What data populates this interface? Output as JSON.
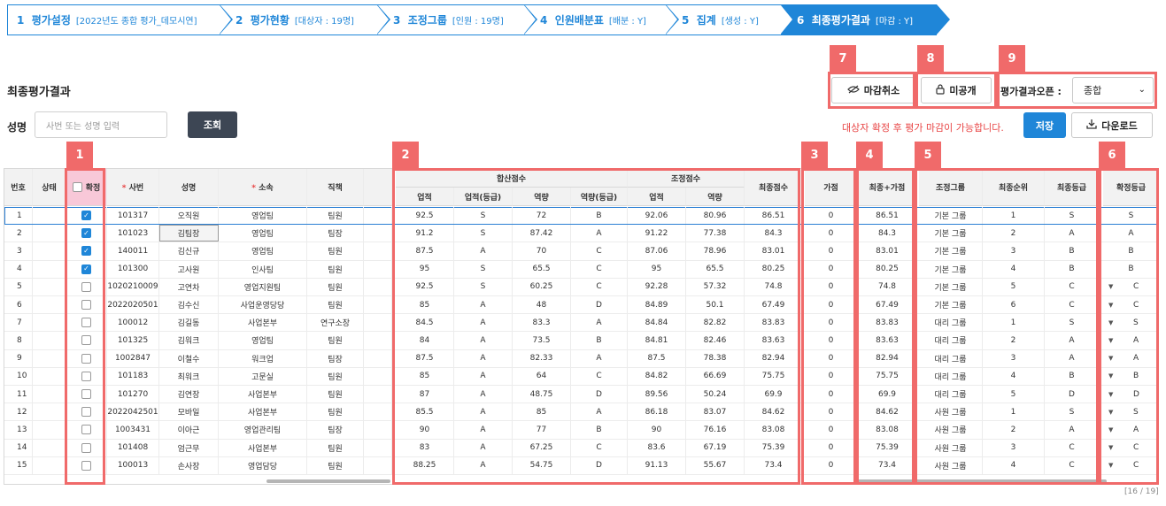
{
  "steps": [
    {
      "num": "1",
      "label": "평가설정",
      "detail": "[2022년도 종합 평가_데모시연]"
    },
    {
      "num": "2",
      "label": "평가현황",
      "detail": "[대상자 : 19명]"
    },
    {
      "num": "3",
      "label": "조정그룹",
      "detail": "[인원 : 19명]"
    },
    {
      "num": "4",
      "label": "인원배분표",
      "detail": "[배분 : Y]"
    },
    {
      "num": "5",
      "label": "집계",
      "detail": "[생성 : Y]"
    },
    {
      "num": "6",
      "label": "최종평가결과",
      "detail": "[마감 : Y]"
    }
  ],
  "page_title": "최종평가결과",
  "toolbar": {
    "close_cancel": "마감취소",
    "private": "미공개",
    "open_label": "평가결과오픈 :",
    "open_value": "종합",
    "notice": "대상자 확정 후 평가 마감이 가능합니다.",
    "save": "저장",
    "download": "다운로드"
  },
  "search": {
    "label": "성명",
    "placeholder": "사번 또는 성명 입력",
    "button": "조회"
  },
  "annotations": [
    "1",
    "2",
    "3",
    "4",
    "5",
    "6",
    "7",
    "8",
    "9"
  ],
  "grid": {
    "group_headers": {
      "sum": "합산점수",
      "adj": "조정점수"
    },
    "headers": {
      "no": "번호",
      "status": "상태",
      "confirm": "확정",
      "emp_no": "사번",
      "name": "성명",
      "dept": "소속",
      "title": "직책",
      "perf": "업적",
      "perf_grade": "업적(등급)",
      "comp": "역량",
      "comp_grade": "역량(등급)",
      "adj_perf": "업적",
      "adj_comp": "역량",
      "final_score": "최종점수",
      "bonus": "가점",
      "final_plus": "최종+가점",
      "adj_group": "조정그룹",
      "final_rank": "최종순위",
      "final_grade": "최종등급",
      "confirmed_grade": "확정등급"
    },
    "rows": [
      {
        "no": "1",
        "checked": true,
        "emp_no": "101317",
        "name": "오직원",
        "dept": "영업팀",
        "title": "팀원",
        "perf": "92.5",
        "perf_grade": "S",
        "comp": "72",
        "comp_grade": "B",
        "adj_perf": "92.06",
        "adj_comp": "80.96",
        "final_score": "86.51",
        "bonus": "0",
        "final_plus": "86.51",
        "adj_group": "기본 그룹",
        "final_rank": "1",
        "final_grade": "S",
        "confirmed_grade": "S",
        "dropdown": false
      },
      {
        "no": "2",
        "checked": true,
        "emp_no": "101023",
        "name": "김팀장",
        "dept": "영업팀",
        "title": "팀장",
        "perf": "91.2",
        "perf_grade": "S",
        "comp": "87.42",
        "comp_grade": "A",
        "adj_perf": "91.22",
        "adj_comp": "77.38",
        "final_score": "84.3",
        "bonus": "0",
        "final_plus": "84.3",
        "adj_group": "기본 그룹",
        "final_rank": "2",
        "final_grade": "A",
        "confirmed_grade": "A",
        "dropdown": false
      },
      {
        "no": "3",
        "checked": true,
        "emp_no": "140011",
        "name": "김신규",
        "dept": "영업팀",
        "title": "팀원",
        "perf": "87.5",
        "perf_grade": "A",
        "comp": "70",
        "comp_grade": "C",
        "adj_perf": "87.06",
        "adj_comp": "78.96",
        "final_score": "83.01",
        "bonus": "0",
        "final_plus": "83.01",
        "adj_group": "기본 그룹",
        "final_rank": "3",
        "final_grade": "B",
        "confirmed_grade": "B",
        "dropdown": false
      },
      {
        "no": "4",
        "checked": true,
        "emp_no": "101300",
        "name": "고사원",
        "dept": "인사팀",
        "title": "팀원",
        "perf": "95",
        "perf_grade": "S",
        "comp": "65.5",
        "comp_grade": "C",
        "adj_perf": "95",
        "adj_comp": "65.5",
        "final_score": "80.25",
        "bonus": "0",
        "final_plus": "80.25",
        "adj_group": "기본 그룹",
        "final_rank": "4",
        "final_grade": "B",
        "confirmed_grade": "B",
        "dropdown": false
      },
      {
        "no": "5",
        "checked": false,
        "emp_no": "1020210009",
        "name": "고연차",
        "dept": "영업지원팀",
        "title": "팀원",
        "perf": "92.5",
        "perf_grade": "S",
        "comp": "60.25",
        "comp_grade": "C",
        "adj_perf": "92.28",
        "adj_comp": "57.32",
        "final_score": "74.8",
        "bonus": "0",
        "final_plus": "74.8",
        "adj_group": "기본 그룹",
        "final_rank": "5",
        "final_grade": "C",
        "confirmed_grade": "C",
        "dropdown": true
      },
      {
        "no": "6",
        "checked": false,
        "emp_no": "2022020501",
        "name": "김수신",
        "dept": "사업운영당당",
        "title": "팀원",
        "perf": "85",
        "perf_grade": "A",
        "comp": "48",
        "comp_grade": "D",
        "adj_perf": "84.89",
        "adj_comp": "50.1",
        "final_score": "67.49",
        "bonus": "0",
        "final_plus": "67.49",
        "adj_group": "기본 그룹",
        "final_rank": "6",
        "final_grade": "C",
        "confirmed_grade": "C",
        "dropdown": true
      },
      {
        "no": "7",
        "checked": false,
        "emp_no": "100012",
        "name": "김길동",
        "dept": "사업본부",
        "title": "연구소장",
        "perf": "84.5",
        "perf_grade": "A",
        "comp": "83.3",
        "comp_grade": "A",
        "adj_perf": "84.84",
        "adj_comp": "82.82",
        "final_score": "83.83",
        "bonus": "0",
        "final_plus": "83.83",
        "adj_group": "대리 그룹",
        "final_rank": "1",
        "final_grade": "S",
        "confirmed_grade": "S",
        "dropdown": true
      },
      {
        "no": "8",
        "checked": false,
        "emp_no": "101325",
        "name": "김워크",
        "dept": "영업팀",
        "title": "팀원",
        "perf": "84",
        "perf_grade": "A",
        "comp": "73.5",
        "comp_grade": "B",
        "adj_perf": "84.81",
        "adj_comp": "82.46",
        "final_score": "83.63",
        "bonus": "0",
        "final_plus": "83.63",
        "adj_group": "대리 그룹",
        "final_rank": "2",
        "final_grade": "A",
        "confirmed_grade": "A",
        "dropdown": true
      },
      {
        "no": "9",
        "checked": false,
        "emp_no": "1002847",
        "name": "이철수",
        "dept": "워크업",
        "title": "팀장",
        "perf": "87.5",
        "perf_grade": "A",
        "comp": "82.33",
        "comp_grade": "A",
        "adj_perf": "87.5",
        "adj_comp": "78.38",
        "final_score": "82.94",
        "bonus": "0",
        "final_plus": "82.94",
        "adj_group": "대리 그룹",
        "final_rank": "3",
        "final_grade": "A",
        "confirmed_grade": "A",
        "dropdown": true
      },
      {
        "no": "10",
        "checked": false,
        "emp_no": "101183",
        "name": "최워크",
        "dept": "고문실",
        "title": "팀원",
        "perf": "85",
        "perf_grade": "A",
        "comp": "64",
        "comp_grade": "C",
        "adj_perf": "84.82",
        "adj_comp": "66.69",
        "final_score": "75.75",
        "bonus": "0",
        "final_plus": "75.75",
        "adj_group": "대리 그룹",
        "final_rank": "4",
        "final_grade": "B",
        "confirmed_grade": "B",
        "dropdown": true
      },
      {
        "no": "11",
        "checked": false,
        "emp_no": "101270",
        "name": "김연장",
        "dept": "사업본부",
        "title": "팀원",
        "perf": "87",
        "perf_grade": "A",
        "comp": "48.75",
        "comp_grade": "D",
        "adj_perf": "89.56",
        "adj_comp": "50.24",
        "final_score": "69.9",
        "bonus": "0",
        "final_plus": "69.9",
        "adj_group": "대리 그룹",
        "final_rank": "5",
        "final_grade": "D",
        "confirmed_grade": "D",
        "dropdown": true
      },
      {
        "no": "12",
        "checked": false,
        "emp_no": "2022042501",
        "name": "모바일",
        "dept": "사업본부",
        "title": "팀원",
        "perf": "85.5",
        "perf_grade": "A",
        "comp": "85",
        "comp_grade": "A",
        "adj_perf": "86.18",
        "adj_comp": "83.07",
        "final_score": "84.62",
        "bonus": "0",
        "final_plus": "84.62",
        "adj_group": "사원 그룹",
        "final_rank": "1",
        "final_grade": "S",
        "confirmed_grade": "S",
        "dropdown": true
      },
      {
        "no": "13",
        "checked": false,
        "emp_no": "1003431",
        "name": "이아근",
        "dept": "영업관리팀",
        "title": "팀장",
        "perf": "90",
        "perf_grade": "A",
        "comp": "77",
        "comp_grade": "B",
        "adj_perf": "90",
        "adj_comp": "76.16",
        "final_score": "83.08",
        "bonus": "0",
        "final_plus": "83.08",
        "adj_group": "사원 그룹",
        "final_rank": "2",
        "final_grade": "A",
        "confirmed_grade": "A",
        "dropdown": true
      },
      {
        "no": "14",
        "checked": false,
        "emp_no": "101408",
        "name": "엄근무",
        "dept": "사업본부",
        "title": "팀원",
        "perf": "83",
        "perf_grade": "A",
        "comp": "67.25",
        "comp_grade": "C",
        "adj_perf": "83.6",
        "adj_comp": "67.19",
        "final_score": "75.39",
        "bonus": "0",
        "final_plus": "75.39",
        "adj_group": "사원 그룹",
        "final_rank": "3",
        "final_grade": "C",
        "confirmed_grade": "C",
        "dropdown": true
      },
      {
        "no": "15",
        "checked": false,
        "emp_no": "100013",
        "name": "손사장",
        "dept": "영업담당",
        "title": "팀원",
        "perf": "88.25",
        "perf_grade": "A",
        "comp": "54.75",
        "comp_grade": "D",
        "adj_perf": "91.13",
        "adj_comp": "55.67",
        "final_score": "73.4",
        "bonus": "0",
        "final_plus": "73.4",
        "adj_group": "사원 그룹",
        "final_rank": "4",
        "final_grade": "C",
        "confirmed_grade": "C",
        "dropdown": true
      }
    ],
    "page_counter": "[16 / 19]"
  }
}
